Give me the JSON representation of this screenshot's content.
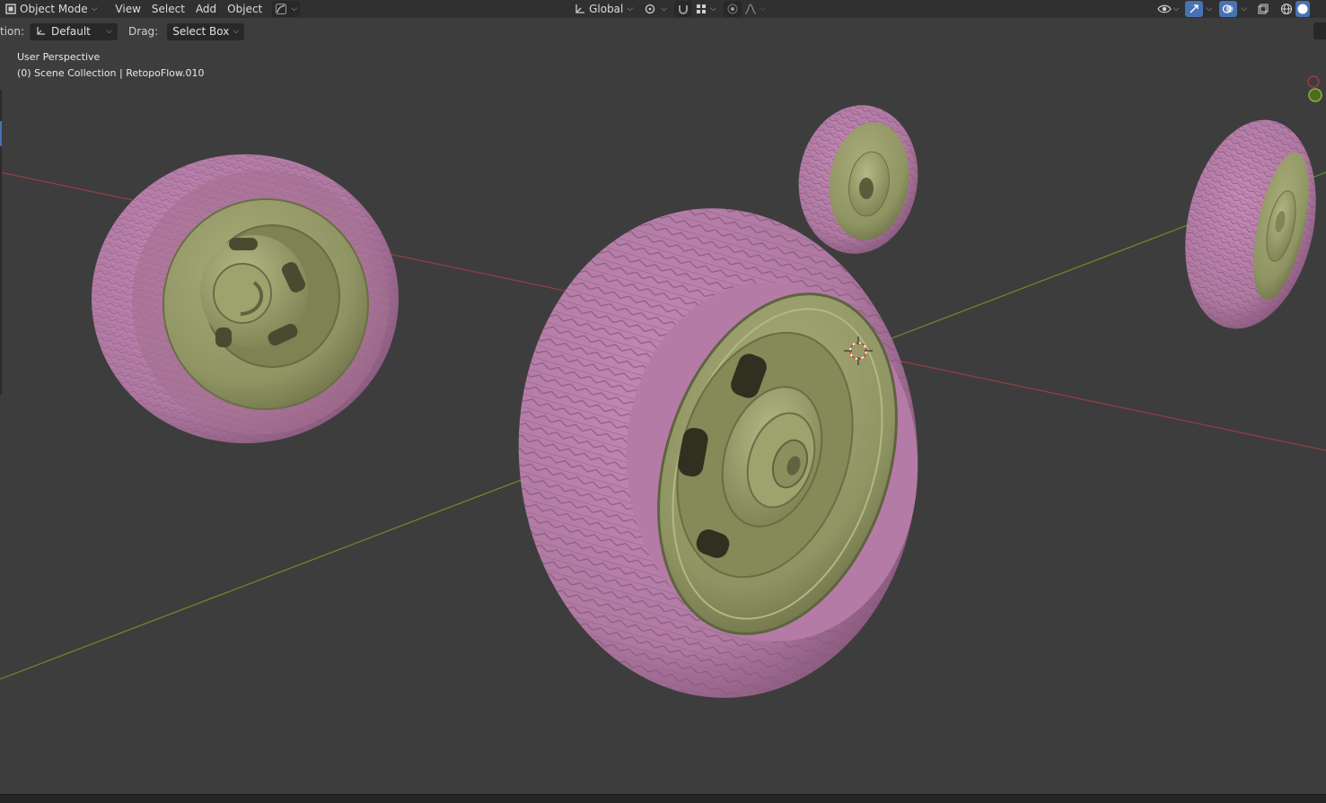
{
  "header": {
    "mode_label": "Object Mode",
    "menu": [
      "View",
      "Select",
      "Add",
      "Object"
    ],
    "transform_orientation": "Global"
  },
  "tool_settings": {
    "orientation_label": "tion:",
    "orientation_value": "Default",
    "drag_label": "Drag:",
    "drag_value": "Select Box"
  },
  "viewport": {
    "view_name": "User Perspective",
    "collection_info": "(0) Scene Collection | RetopoFlow.010"
  },
  "colors": {
    "tire": "#b47ba6",
    "rim": "#8f9463",
    "x_axis": "#9a3c46",
    "y_axis": "#6a8f2c",
    "background": "#3d3d3d",
    "accent": "#4772b3"
  },
  "icons": {
    "mode": "object-mode-icon",
    "orientation": "transform-orientation-icon",
    "pivot": "pivot-point-icon",
    "snap": "snap-magnet-icon",
    "proportional": "proportional-editing-icon",
    "visibility": "eye-icon",
    "gizmo": "gizmo-icon",
    "overlay": "overlay-icon",
    "xray": "xray-icon",
    "wireframe": "wireframe-shading-icon",
    "solid": "solid-shading-icon",
    "cursor": "3d-cursor-icon"
  }
}
